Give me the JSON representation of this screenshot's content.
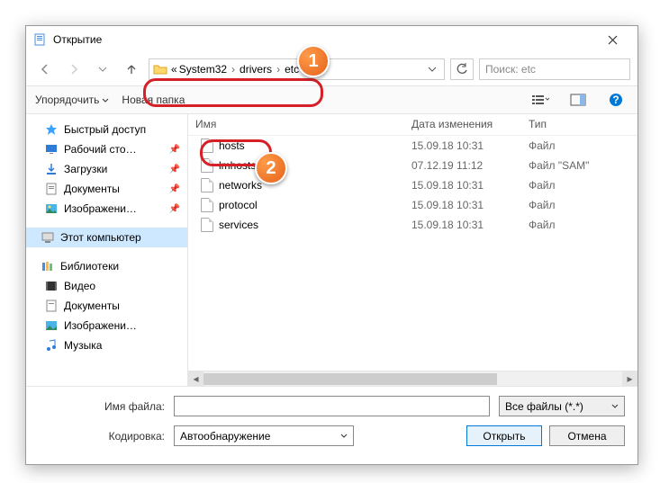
{
  "window": {
    "title": "Открытие"
  },
  "nav": {
    "breadcrumbs_prefix": "«",
    "crumbs": [
      "System32",
      "drivers",
      "etc"
    ],
    "search_placeholder": "Поиск: etc"
  },
  "toolbar": {
    "organize": "Упорядочить",
    "new_folder": "Новая папка"
  },
  "sidebar": {
    "items": [
      {
        "icon": "star",
        "label": "Быстрый доступ",
        "pin": false
      },
      {
        "icon": "desktop",
        "label": "Рабочий сто…",
        "pin": true
      },
      {
        "icon": "download",
        "label": "Загрузки",
        "pin": true
      },
      {
        "icon": "doc",
        "label": "Документы",
        "pin": true
      },
      {
        "icon": "pic",
        "label": "Изображени…",
        "pin": true
      }
    ],
    "this_pc": "Этот компьютер",
    "libraries": "Библиотеки",
    "lib_items": [
      {
        "icon": "video",
        "label": "Видео"
      },
      {
        "icon": "doc",
        "label": "Документы"
      },
      {
        "icon": "pic",
        "label": "Изображени…"
      },
      {
        "icon": "music",
        "label": "Музыка"
      }
    ]
  },
  "columns": {
    "name": "Имя",
    "date": "Дата изменения",
    "type": "Тип"
  },
  "files": [
    {
      "name": "hosts",
      "date": "15.09.18 10:31",
      "type": "Файл"
    },
    {
      "name": "lmhosts.sam",
      "date": "07.12.19 11:12",
      "type": "Файл \"SAM\""
    },
    {
      "name": "networks",
      "date": "15.09.18 10:31",
      "type": "Файл"
    },
    {
      "name": "protocol",
      "date": "15.09.18 10:31",
      "type": "Файл"
    },
    {
      "name": "services",
      "date": "15.09.18 10:31",
      "type": "Файл"
    }
  ],
  "bottom": {
    "filename_label": "Имя файла:",
    "filename_value": "",
    "filter": "Все файлы  (*.*)",
    "encoding_label": "Кодировка:",
    "encoding_value": "Автообнаружение",
    "open": "Открыть",
    "cancel": "Отмена"
  },
  "badges": {
    "one": "1",
    "two": "2"
  }
}
